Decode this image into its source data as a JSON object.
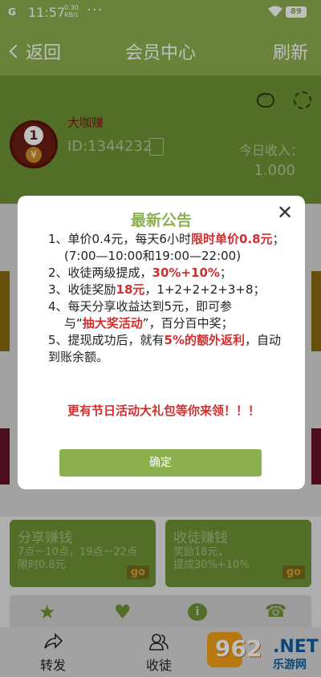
{
  "status_bar": {
    "signal": "G",
    "time": "11:57",
    "speed_value": "0.30",
    "speed_unit": "KB/s",
    "dots": "···",
    "battery": "89"
  },
  "title_bar": {
    "back_label": "返回",
    "title": "会员中心",
    "refresh_label": "刷新"
  },
  "profile": {
    "nickname": "大咖赚",
    "avatar_number": "1",
    "avatar_coin": "¥",
    "id": "ID:1344232",
    "today_label": "今日收入：",
    "today_value": "1.000"
  },
  "cards": [
    {
      "title": "分享赚钱",
      "line1": "7点一10点，19点一22点",
      "line2": "限时0.8元",
      "go": "go"
    },
    {
      "title": "收徒赚钱",
      "line1": "奖励18元，",
      "line2": "提成30%+10%",
      "go": "go"
    }
  ],
  "icons": {
    "info": "i"
  },
  "tabbar": {
    "forward_label": "转发",
    "recruit_label": "收徒"
  },
  "watermark": {
    "num": "962",
    "net": ".NET",
    "cn": "乐游网"
  },
  "modal": {
    "title": "最新公告",
    "line1_a": "1、单价0.4元，每天6小时",
    "line1_red": "限时单价0.8元",
    "line1_b": "；",
    "line1_time": "(7:00—10:00和19:00—22:00)",
    "line2_a": "2、收徒两级提成，",
    "line2_red": "30%+10%",
    "line2_b": "；",
    "line3_a": "3、收徒奖励",
    "line3_red": "18元",
    "line3_b": "，1+2+2+2+3+8；",
    "line4_a": "4、每天分享收益达到5元，即可参",
    "line4_b": "与“",
    "line4_red": "抽大奖活动",
    "line4_c": "”，百分百中奖；",
    "line5_a": "5、提现成功后，就有",
    "line5_red": "5%的额外返利",
    "line5_b": "，自动到账余额。",
    "promo": "更有节日活动大礼包等你来领！！！",
    "confirm_label": "确定",
    "close_symbol": "✕"
  }
}
